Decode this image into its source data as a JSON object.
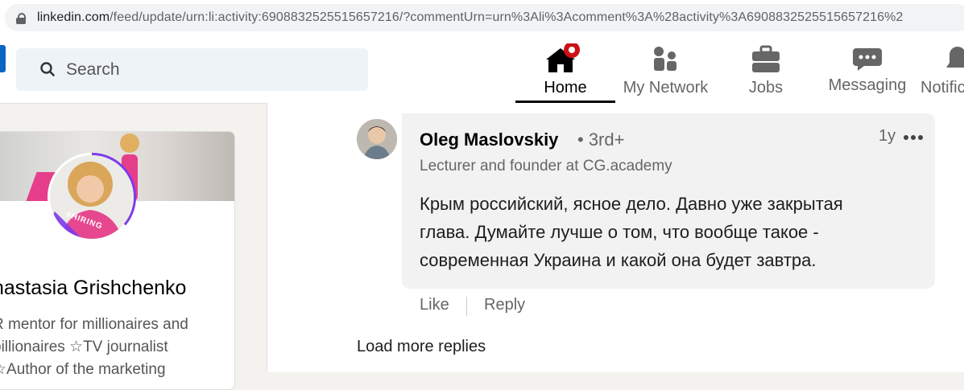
{
  "browser": {
    "url_host": "linkedin.com",
    "url_path": "/feed/update/urn:li:activity:6908832525515657216/?commentUrn=urn%3Ali%3Acomment%3A%28activity%3A6908832525515657216%2"
  },
  "nav": {
    "search_placeholder": "Search",
    "items": [
      {
        "label": "Home",
        "icon": "home-icon",
        "active": true
      },
      {
        "label": "My Network",
        "icon": "network-icon"
      },
      {
        "label": "Jobs",
        "icon": "briefcase-icon"
      },
      {
        "label": "Messaging",
        "icon": "messaging-icon"
      },
      {
        "label": "Notific",
        "icon": "bell-icon"
      }
    ]
  },
  "profile": {
    "name": "nastasia Grishchenko",
    "badge": "#HIRING",
    "desc_lines": [
      "R mentor for millionaires and",
      "billionaires ☆TV journalist",
      "☆Author of the marketing"
    ]
  },
  "comment": {
    "author": "Oleg Maslovskiy",
    "degree": "• 3rd+",
    "time": "1y",
    "headline": "Lecturer and founder at CG.academy",
    "text_lines": [
      "Крым российский, ясное дело. Давно уже закрытая",
      "глава. Думайте лучше о том, что вообще такое -",
      "современная Украина и какой она будет завтра."
    ],
    "like_label": "Like",
    "reply_label": "Reply"
  },
  "load_more_label": "Load more replies",
  "colors": {
    "brand": "#0a66c2",
    "notification_badge": "#cc1016",
    "hiring_ring": "#7c3aed"
  }
}
